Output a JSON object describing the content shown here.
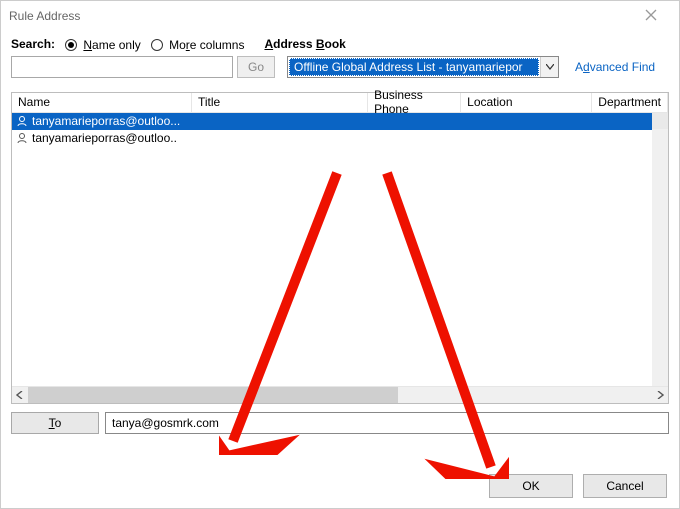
{
  "window": {
    "title": "Rule Address"
  },
  "search": {
    "label": "Search:",
    "option_name_only": "Name only",
    "option_more_columns": "More columns",
    "selected": "name_only",
    "go_label": "Go",
    "value": ""
  },
  "address_book": {
    "label": "Address Book",
    "dropdown_value": "Offline Global Address List - tanyamariepor",
    "advanced_find": "Advanced Find"
  },
  "columns": {
    "name": "Name",
    "title": "Title",
    "phone": "Business Phone",
    "location": "Location",
    "department": "Department"
  },
  "rows": [
    {
      "name": "tanyamarieporras@outloo...",
      "selected": true
    },
    {
      "name": "tanyamarieporras@outloo..",
      "selected": false
    }
  ],
  "to": {
    "button_label": "To",
    "value": "tanya@gosmrk.com"
  },
  "buttons": {
    "ok": "OK",
    "cancel": "Cancel"
  }
}
